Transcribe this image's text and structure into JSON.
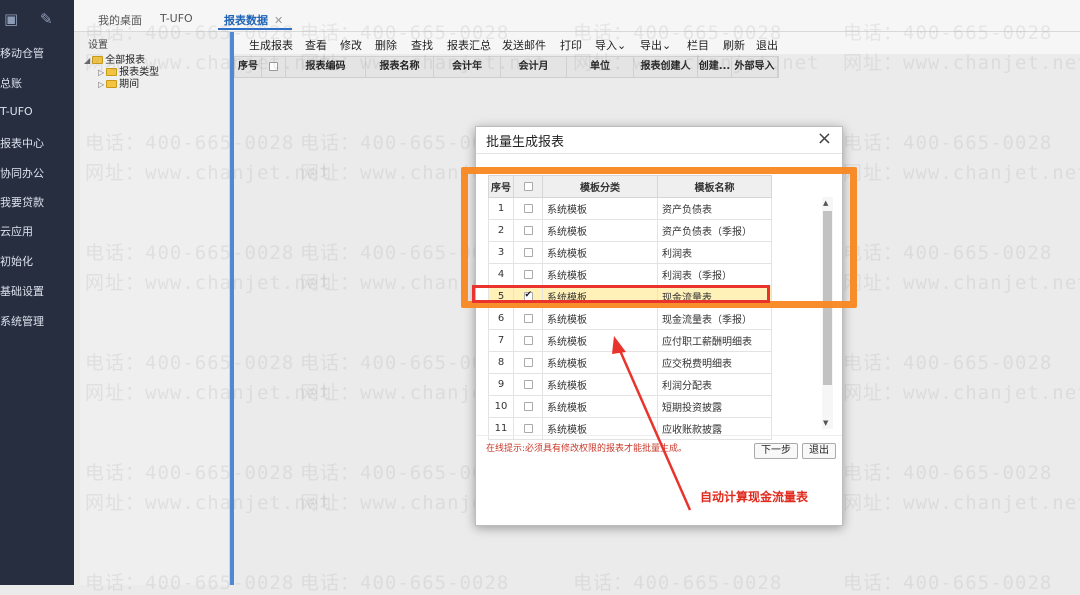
{
  "sidebar": {
    "items": [
      "移动仓管",
      "总账",
      "T-UFO",
      "报表中心",
      "协同办公",
      "我要贷款",
      "云应用",
      "初始化",
      "基础设置",
      "系统管理"
    ]
  },
  "tabs": [
    {
      "label": "我的桌面"
    },
    {
      "label": "T-UFO"
    },
    {
      "label": "报表数据",
      "close": "✕"
    }
  ],
  "tree": {
    "header": "设置",
    "root": "全部报表",
    "children": [
      "报表类型",
      "期间"
    ]
  },
  "toolbar": {
    "buttons": [
      "生成报表",
      "查看",
      "修改",
      "删除",
      "查找",
      "报表汇总",
      "发送邮件",
      "打印",
      "导入",
      "导出",
      "栏目",
      "刷新",
      "退出"
    ],
    "dropdown_glyph": "⌄"
  },
  "grid": {
    "columns": [
      "序号",
      "",
      "报表编码",
      "报表名称",
      "会计年",
      "会计月",
      "单位",
      "报表创建人",
      "创建...",
      "外部导入"
    ]
  },
  "watermark": {
    "phone": "电话：400-665-0028",
    "site": "网址：www.chanjet.net"
  },
  "dialog": {
    "title": "批量生成报表",
    "close": "×",
    "columns": [
      "序号",
      "",
      "模板分类",
      "模板名称"
    ],
    "rows": [
      {
        "no": "1",
        "checked": false,
        "category": "系统模板",
        "name": "资产负债表"
      },
      {
        "no": "2",
        "checked": false,
        "category": "系统模板",
        "name": "资产负债表（季报）"
      },
      {
        "no": "3",
        "checked": false,
        "category": "系统模板",
        "name": "利润表"
      },
      {
        "no": "4",
        "checked": false,
        "category": "系统模板",
        "name": "利润表（季报）"
      },
      {
        "no": "5",
        "checked": true,
        "category": "系统模板",
        "name": "现金流量表"
      },
      {
        "no": "6",
        "checked": false,
        "category": "系统模板",
        "name": "现金流量表（季报）"
      },
      {
        "no": "7",
        "checked": false,
        "category": "系统模板",
        "name": "应付职工薪酬明细表"
      },
      {
        "no": "8",
        "checked": false,
        "category": "系统模板",
        "name": "应交税费明细表"
      },
      {
        "no": "9",
        "checked": false,
        "category": "系统模板",
        "name": "利润分配表"
      },
      {
        "no": "10",
        "checked": false,
        "category": "系统模板",
        "name": "短期投资披露"
      },
      {
        "no": "11",
        "checked": false,
        "category": "系统模板",
        "name": "应收账款披露"
      }
    ],
    "tip": "在线提示:必须具有修改权限的报表才能批量生成。",
    "next_button": "下一步",
    "exit_button": "退出"
  },
  "annotation": {
    "text": "自动计算现金流量表",
    "color": "#e02a1d"
  },
  "colors": {
    "sidebar_bg": "#262e3f",
    "active_tab": "#1e63b5",
    "highlight_orange": "#f98721",
    "highlight_red": "#e8342c",
    "selected_row": "#fff1b8"
  }
}
